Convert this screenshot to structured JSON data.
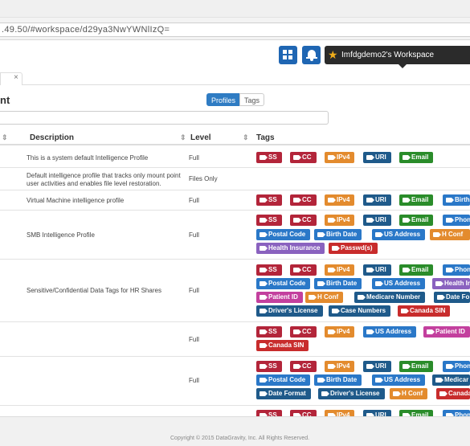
{
  "browser": {
    "url": ".49.50/#workspace/d29ya3NwYWNlIzQ="
  },
  "header": {
    "workspace_label": "Imfdgdemo2's Workspace",
    "apps_icon": "grid-icon",
    "notifications_icon": "bell-icon",
    "star_icon": "star-icon"
  },
  "tab": {
    "close_symbol": "×"
  },
  "page": {
    "title": "nt",
    "toggle_profiles": "Profiles",
    "toggle_tags": "Tags"
  },
  "table": {
    "columns": {
      "description": "Description",
      "level": "Level",
      "tags": "Tags"
    }
  },
  "colors": {
    "red": "#b3253a",
    "orange": "#e38b2e",
    "navy": "#1f5a8a",
    "green": "#2a8c2a",
    "blue": "#2a78c8",
    "purple": "#8a62bf",
    "pink": "#c3409e",
    "darkred": "#c82c2c"
  },
  "rows": [
    {
      "description": "This is a system default Intelligence Profile",
      "level": "Full"
    },
    {
      "description": "Default intelligence profile that tracks only mount point user activities and enables file level restoration.",
      "level": "Files Only"
    },
    {
      "description": "Virtual Machine intelligence profile",
      "level": "Full"
    },
    {
      "description": "SMB Intelligence Profile",
      "level": "Full"
    },
    {
      "description": "Sensitive/Confidential Data Tags for HR Shares",
      "level": "Full"
    },
    {
      "description": "",
      "level": "Full"
    },
    {
      "description": "",
      "level": "Full"
    }
  ],
  "tags": {
    "ss": "SS",
    "cc": "CC",
    "ipv4": "IPv4",
    "uri": "URI",
    "email": "Email",
    "birth": "Birth",
    "phone": "Phon",
    "postal": "Postal Code",
    "birthdate": "Birth Date",
    "usaddr": "US Address",
    "hconf": "H Conf",
    "hhealth": "Health Insurance",
    "passwd": "Passwd(s)",
    "healthi": "Health Ir",
    "patient": "Patient ID",
    "medicare": "Medicare Number",
    "datefo": "Date Fo",
    "dl": "Driver's License",
    "casenum": "Case Numbers",
    "canada": "Canada SIN",
    "medicar2": "Medicar",
    "datefmt": "Date Format",
    "canad2": "Canada"
  },
  "footer": {
    "copyright": "Copyright © 2015 DataGravity, Inc. All Rights Reserved."
  }
}
